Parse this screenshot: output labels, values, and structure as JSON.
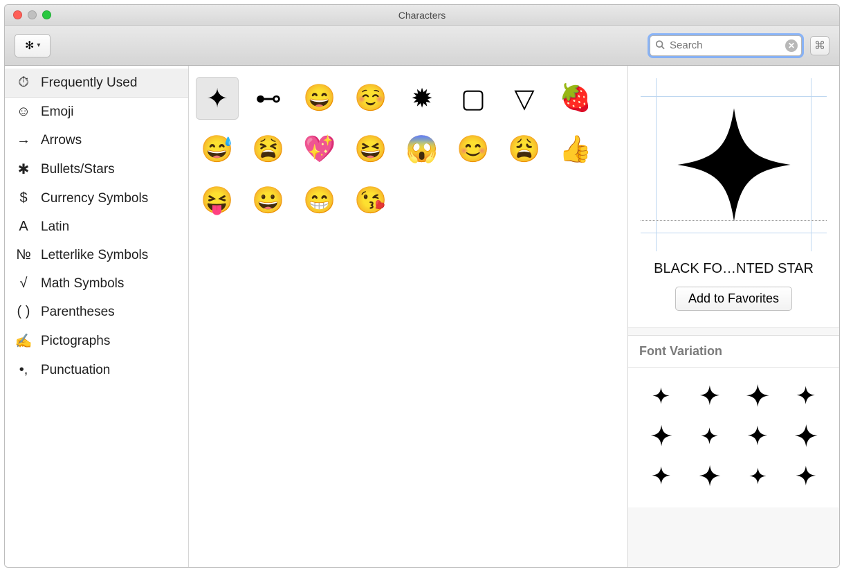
{
  "window": {
    "title": "Characters"
  },
  "search": {
    "placeholder": "Search",
    "value": ""
  },
  "sidebar": {
    "items": [
      {
        "label": "Frequently Used",
        "icon": "⏱",
        "selected": true
      },
      {
        "label": "Emoji",
        "icon": "☺",
        "selected": false
      },
      {
        "label": "Arrows",
        "icon": "→",
        "selected": false
      },
      {
        "label": "Bullets/Stars",
        "icon": "✱",
        "selected": false
      },
      {
        "label": "Currency Symbols",
        "icon": "$",
        "selected": false
      },
      {
        "label": "Latin",
        "icon": "A",
        "selected": false
      },
      {
        "label": "Letterlike Symbols",
        "icon": "№",
        "selected": false
      },
      {
        "label": "Math Symbols",
        "icon": "√",
        "selected": false
      },
      {
        "label": "Parentheses",
        "icon": "( )",
        "selected": false
      },
      {
        "label": "Pictographs",
        "icon": "✍",
        "selected": false
      },
      {
        "label": "Punctuation",
        "icon": "•,",
        "selected": false
      }
    ]
  },
  "characters": [
    {
      "glyph": "✦",
      "name": "black-four-pointed-star",
      "selected": true
    },
    {
      "glyph": "⊷",
      "name": "image-of"
    },
    {
      "glyph": "😄",
      "name": "smiling-face-open-mouth"
    },
    {
      "glyph": "☺️",
      "name": "smiling-face"
    },
    {
      "glyph": "✹",
      "name": "twelve-pointed-star"
    },
    {
      "glyph": "▢",
      "name": "white-square"
    },
    {
      "glyph": "▽",
      "name": "white-down-triangle"
    },
    {
      "glyph": "🍓",
      "name": "strawberry"
    },
    {
      "glyph": "😅",
      "name": "smiling-face-cold-sweat"
    },
    {
      "glyph": "😫",
      "name": "tired-face"
    },
    {
      "glyph": "💖",
      "name": "sparkling-heart"
    },
    {
      "glyph": "😆",
      "name": "smiling-face-tightly-closed-eyes"
    },
    {
      "glyph": "😱",
      "name": "face-screaming"
    },
    {
      "glyph": "😊",
      "name": "smiling-face-smiling-eyes"
    },
    {
      "glyph": "😩",
      "name": "weary-face"
    },
    {
      "glyph": "👍",
      "name": "thumbs-up"
    },
    {
      "glyph": "😝",
      "name": "face-stuck-out-tongue-closed-eyes"
    },
    {
      "glyph": "😀",
      "name": "grinning-face"
    },
    {
      "glyph": "😁",
      "name": "grinning-face-smiling-eyes"
    },
    {
      "glyph": "😘",
      "name": "face-throwing-a-kiss"
    }
  ],
  "inspector": {
    "character_name": "BLACK FO…NTED STAR",
    "add_to_favorites": "Add to Favorites",
    "font_variation_label": "Font Variation",
    "variation_count": 12
  }
}
